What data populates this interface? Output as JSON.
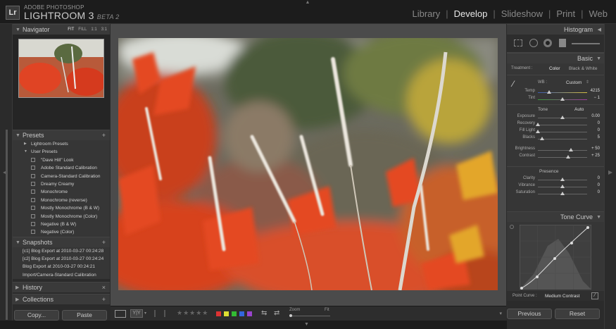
{
  "app": {
    "brand_line1": "ADOBE PHOTOSHOP",
    "brand_line2": "LIGHTROOM 3",
    "brand_beta": "BETA 2",
    "logo": "Lr"
  },
  "modules": [
    {
      "label": "Library"
    },
    {
      "label": "Develop",
      "active": true
    },
    {
      "label": "Slideshow"
    },
    {
      "label": "Print"
    },
    {
      "label": "Web"
    }
  ],
  "navigator": {
    "title": "Navigator",
    "opts": [
      "FIT",
      "FILL",
      "1:1",
      "3:1"
    ]
  },
  "presets": {
    "title": "Presets",
    "groups": [
      "Lightroom Presets",
      "User Presets"
    ],
    "items": [
      "\"Dave Hill\" Look",
      "Adobe Standard Calibration",
      "Camera-Standard Calibration",
      "Dreamy Creamy",
      "Monochrome",
      "Monochrome (reverse)",
      "Mostly Monochrome (B & W)",
      "Mostly Monochrome (Color)",
      "Negative (B & W)",
      "Negative (Color)"
    ]
  },
  "snapshots": {
    "title": "Snapshots",
    "items": [
      "[c1] Blog Export at 2010-03-27 00:24:28",
      "[c2] Blog Export at 2010-03-27 00:24:24",
      "Blog Export at 2010-03-27 00:24:21",
      "Import/Camera-Standard Calibration"
    ]
  },
  "history": {
    "title": "History"
  },
  "collections": {
    "title": "Collections"
  },
  "left_buttons": {
    "copy": "Copy...",
    "paste": "Paste"
  },
  "toolbar": {
    "zoom_label": "Zoom",
    "fit_label": "Fit"
  },
  "histogram": {
    "title": "Histogram"
  },
  "basic": {
    "title": "Basic",
    "treatment_label": "Treatment :",
    "color": "Color",
    "bw": "Black & White",
    "wb_label": "WB :",
    "wb_value": "Custom",
    "temp": {
      "label": "Temp",
      "value": "4215"
    },
    "tint": {
      "label": "Tint",
      "value": "− 1"
    },
    "tone_label": "Tone",
    "auto": "Auto",
    "tone_rows": [
      {
        "label": "Exposure",
        "value": "0.00",
        "pos": 0.5
      },
      {
        "label": "Recovery",
        "value": "0",
        "pos": 0.0
      },
      {
        "label": "Fill Light",
        "value": "0",
        "pos": 0.0
      },
      {
        "label": "Blacks",
        "value": "5",
        "pos": 0.08
      },
      {
        "label": "Brightness",
        "value": "+ 50",
        "pos": 0.67
      },
      {
        "label": "Contrast",
        "value": "+ 25",
        "pos": 0.62
      }
    ],
    "presence_label": "Presence",
    "presence_rows": [
      {
        "label": "Clarity",
        "value": "0",
        "pos": 0.5
      },
      {
        "label": "Vibrance",
        "value": "0",
        "pos": 0.5
      },
      {
        "label": "Saturation",
        "value": "0",
        "pos": 0.5
      }
    ]
  },
  "tone_curve": {
    "title": "Tone Curve",
    "point_curve_label": "Point Curve :",
    "point_curve_value": "Medium Contrast"
  },
  "right_buttons": {
    "previous": "Previous",
    "reset": "Reset"
  },
  "colors": {
    "accent_red": "#e0502a",
    "panel": "#363636"
  }
}
